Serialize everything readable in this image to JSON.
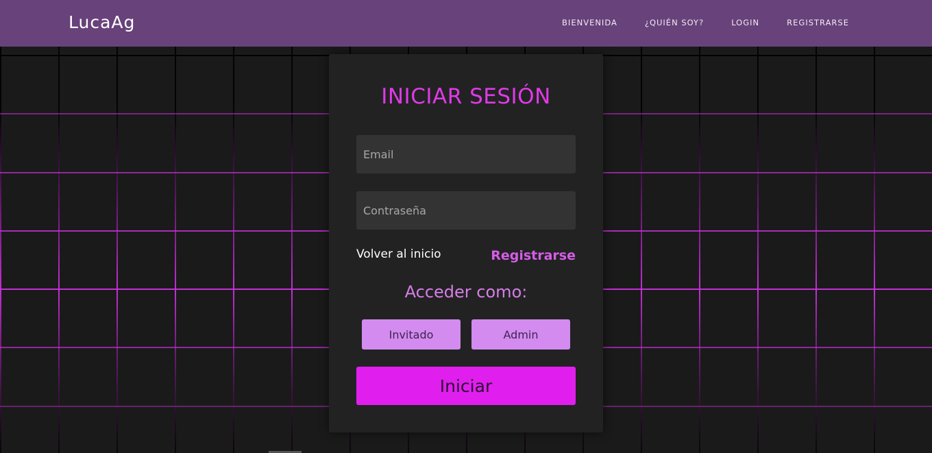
{
  "navbar": {
    "brand": "LucaAg",
    "links": [
      "BIENVENIDA",
      "¿QUIÉN SOY?",
      "LOGIN",
      "REGISTRARSE"
    ]
  },
  "login": {
    "title": "INICIAR SESIÓN",
    "email_placeholder": "Email",
    "password_placeholder": "Contraseña",
    "back_link": "Volver al inicio",
    "register_link": "Registrarse",
    "access_label": "Acceder como:",
    "guest_button": "Invitado",
    "admin_button": "Admin",
    "submit_button": "Iniciar"
  },
  "colors": {
    "navbar": "#68427a",
    "accent": "#e01fee",
    "card": "#222223",
    "grid_line": "#c42fd6"
  }
}
